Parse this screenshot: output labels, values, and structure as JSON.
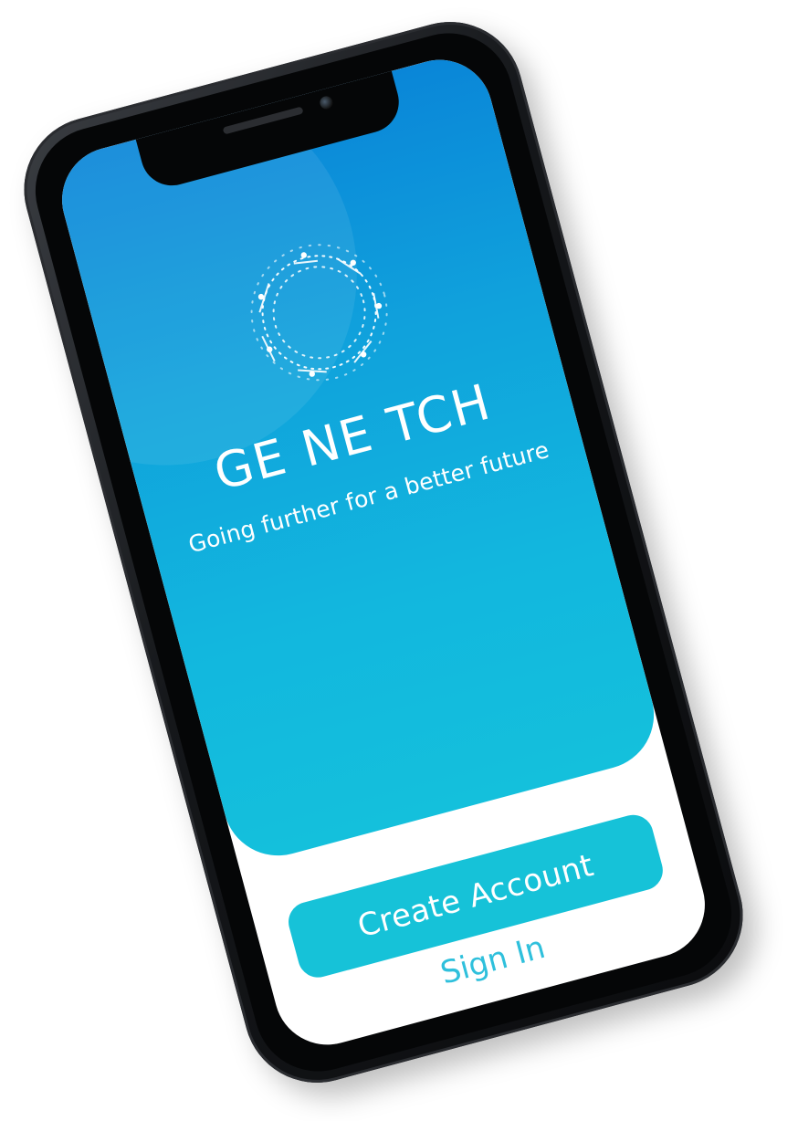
{
  "app": {
    "brand_name": "GE NE TCH",
    "tagline": "Going further for a better future"
  },
  "actions": {
    "create_account_label": "Create Account",
    "sign_in_label": "Sign In"
  },
  "colors": {
    "gradient_top": "#0a86d8",
    "gradient_bottom": "#14c0dc",
    "button_bg": "#16c2d8",
    "sign_in_text": "#2fc0dc",
    "phone_frame": "#15171a"
  },
  "icons": {
    "logo": "dna-ring-icon"
  }
}
